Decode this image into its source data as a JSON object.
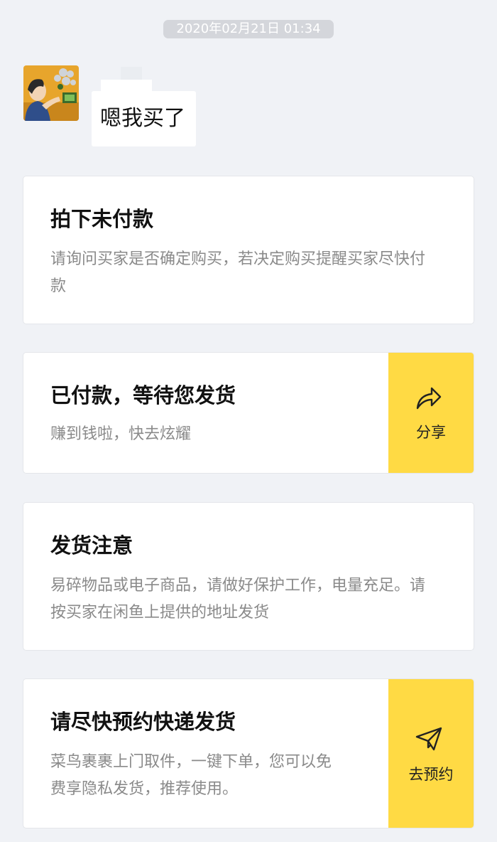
{
  "chat": {
    "timestamp": "2020年02月21日 01:34",
    "message": "嗯我买了"
  },
  "cards": [
    {
      "title": "拍下未付款",
      "desc_line1": "请询问买家是否确定购买，若决定购买提醒买家尽快付",
      "desc_line2": "款"
    },
    {
      "title": "已付款，等待您发货",
      "desc_line1": "赚到钱啦，快去炫耀",
      "action_label": "分享",
      "action_icon": "share-icon"
    },
    {
      "title": "发货注意",
      "desc_line1": "易碎物品或电子商品，请做好保护工作，电量充足。请",
      "desc_line2": "按买家在闲鱼上提供的地址发货"
    },
    {
      "title": "请尽快预约快递发货",
      "desc_line1": "菜鸟裹裹上门取件，一键下单，您可以免",
      "desc_line2": "费享隐私发货，推荐使用。",
      "action_label": "去预约",
      "action_icon": "paper-plane-icon"
    }
  ],
  "colors": {
    "background": "#f0f2f6",
    "action_yellow": "#ffda44",
    "timestamp_pill": "#d4d6db",
    "desc_gray": "#8a8a8a"
  }
}
